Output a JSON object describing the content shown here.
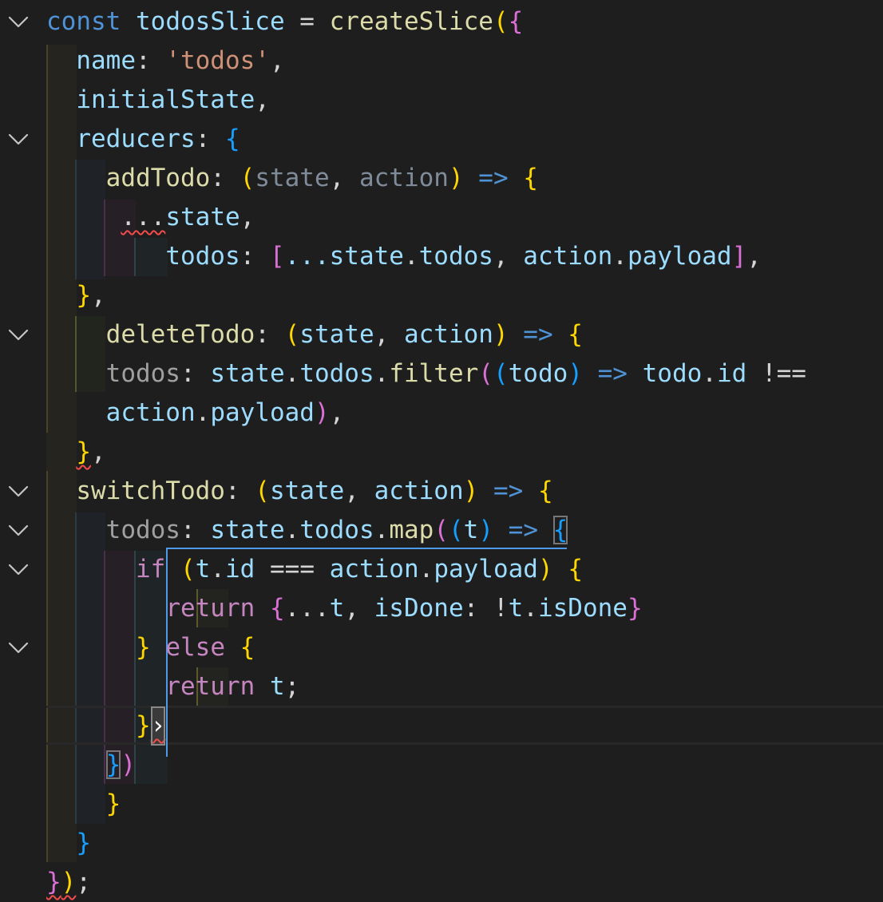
{
  "lines": [
    {
      "t": [
        [
          "kw",
          "const"
        ],
        [
          "punc",
          " "
        ],
        [
          "var",
          "todosSlice"
        ],
        [
          "punc",
          " = "
        ],
        [
          "fn",
          "createSlice"
        ],
        [
          "b1",
          "("
        ],
        [
          "b2",
          "{"
        ]
      ]
    },
    {
      "t": [
        [
          "punc",
          "  "
        ],
        [
          "var",
          "name"
        ],
        [
          "punc",
          ": "
        ],
        [
          "str",
          "'todos'"
        ],
        [
          "punc",
          ","
        ]
      ]
    },
    {
      "t": [
        [
          "punc",
          "  "
        ],
        [
          "var",
          "initialState"
        ],
        [
          "punc",
          ","
        ]
      ]
    },
    {
      "t": [
        [
          "punc",
          "  "
        ],
        [
          "var",
          "reducers"
        ],
        [
          "punc",
          ": "
        ],
        [
          "b3",
          "{"
        ]
      ]
    },
    {
      "t": [
        [
          "punc",
          "    "
        ],
        [
          "fn",
          "addTodo"
        ],
        [
          "punc",
          ": "
        ],
        [
          "b1",
          "("
        ],
        [
          "dim",
          "state"
        ],
        [
          "punc",
          ", "
        ],
        [
          "dim",
          "action"
        ],
        [
          "b1",
          ")"
        ],
        [
          "punc",
          " "
        ],
        [
          "kw",
          "=>"
        ],
        [
          "punc",
          " "
        ],
        [
          "b1",
          "{"
        ]
      ]
    },
    {
      "t": [
        [
          "punc",
          "     "
        ],
        [
          "squig",
          "..."
        ],
        [
          "var",
          "state"
        ],
        [
          "punc",
          ","
        ]
      ]
    },
    {
      "t": [
        [
          "punc",
          "        "
        ],
        [
          "var",
          "todos"
        ],
        [
          "punc",
          ": "
        ],
        [
          "b2",
          "["
        ],
        [
          "var",
          "...state"
        ],
        [
          "punc",
          "."
        ],
        [
          "var",
          "todos"
        ],
        [
          "punc",
          ", "
        ],
        [
          "var",
          "action"
        ],
        [
          "punc",
          "."
        ],
        [
          "var",
          "payload"
        ],
        [
          "b2",
          "]"
        ],
        [
          "punc",
          ","
        ]
      ]
    },
    {
      "t": [
        [
          "punc",
          "  "
        ],
        [
          "b1",
          "}"
        ],
        [
          "punc",
          ","
        ]
      ]
    },
    {
      "t": [
        [
          "punc",
          "    "
        ],
        [
          "fn",
          "deleteTodo"
        ],
        [
          "punc",
          ": "
        ],
        [
          "b1",
          "("
        ],
        [
          "var",
          "state"
        ],
        [
          "punc",
          ", "
        ],
        [
          "var",
          "action"
        ],
        [
          "b1",
          ")"
        ],
        [
          "punc",
          " "
        ],
        [
          "kw",
          "=>"
        ],
        [
          "punc",
          " "
        ],
        [
          "b1",
          "{"
        ]
      ]
    },
    {
      "t": [
        [
          "punc",
          "    "
        ],
        [
          "grey",
          "todos"
        ],
        [
          "punc",
          ": "
        ],
        [
          "var",
          "state"
        ],
        [
          "punc",
          "."
        ],
        [
          "var",
          "todos"
        ],
        [
          "punc",
          "."
        ],
        [
          "fn",
          "filter"
        ],
        [
          "b2",
          "("
        ],
        [
          "b3",
          "("
        ],
        [
          "var",
          "todo"
        ],
        [
          "b3",
          ")"
        ],
        [
          "punc",
          " "
        ],
        [
          "kw",
          "=>"
        ],
        [
          "punc",
          " "
        ],
        [
          "var",
          "todo"
        ],
        [
          "punc",
          "."
        ],
        [
          "var",
          "id"
        ],
        [
          "punc",
          " !=="
        ]
      ]
    },
    {
      "t": [
        [
          "punc",
          "    "
        ],
        [
          "var",
          "action"
        ],
        [
          "punc",
          "."
        ],
        [
          "var",
          "payload"
        ],
        [
          "b2",
          ")"
        ],
        [
          "punc",
          ","
        ]
      ]
    },
    {
      "t": [
        [
          "punc",
          "  "
        ],
        [
          "b1sq",
          "}"
        ],
        [
          "punc",
          ","
        ]
      ]
    },
    {
      "t": [
        [
          "punc",
          "  "
        ],
        [
          "fn",
          "switchTodo"
        ],
        [
          "punc",
          ": "
        ],
        [
          "b1",
          "("
        ],
        [
          "var",
          "state"
        ],
        [
          "punc",
          ", "
        ],
        [
          "var",
          "action"
        ],
        [
          "b1",
          ")"
        ],
        [
          "punc",
          " "
        ],
        [
          "kw",
          "=>"
        ],
        [
          "punc",
          " "
        ],
        [
          "b1",
          "{"
        ]
      ]
    },
    {
      "t": [
        [
          "punc",
          "    "
        ],
        [
          "grey",
          "todos"
        ],
        [
          "punc",
          ": "
        ],
        [
          "var",
          "state"
        ],
        [
          "punc",
          "."
        ],
        [
          "var",
          "todos"
        ],
        [
          "punc",
          "."
        ],
        [
          "fn",
          "map"
        ],
        [
          "b2",
          "("
        ],
        [
          "b3",
          "("
        ],
        [
          "var",
          "t"
        ],
        [
          "b3",
          ")"
        ],
        [
          "punc",
          " "
        ],
        [
          "kw",
          "=>"
        ],
        [
          "punc",
          " "
        ],
        [
          "b3box",
          "{"
        ]
      ]
    },
    {
      "t": [
        [
          "punc",
          "      "
        ],
        [
          "ctl",
          "if"
        ],
        [
          "punc",
          " "
        ],
        [
          "b1",
          "("
        ],
        [
          "var",
          "t"
        ],
        [
          "punc",
          "."
        ],
        [
          "var",
          "id"
        ],
        [
          "punc",
          " === "
        ],
        [
          "var",
          "action"
        ],
        [
          "punc",
          "."
        ],
        [
          "var",
          "payload"
        ],
        [
          "b1",
          ")"
        ],
        [
          "punc",
          " "
        ],
        [
          "b1",
          "{"
        ]
      ]
    },
    {
      "t": [
        [
          "punc",
          "        "
        ],
        [
          "ctl",
          "return"
        ],
        [
          "punc",
          " "
        ],
        [
          "b2",
          "{"
        ],
        [
          "punc",
          "..."
        ],
        [
          "var",
          "t"
        ],
        [
          "punc",
          ", "
        ],
        [
          "var",
          "isDone"
        ],
        [
          "punc",
          ": !"
        ],
        [
          "var",
          "t"
        ],
        [
          "punc",
          "."
        ],
        [
          "var",
          "isDone"
        ],
        [
          "b2",
          "}"
        ]
      ]
    },
    {
      "t": [
        [
          "punc",
          "      "
        ],
        [
          "b1",
          "}"
        ],
        [
          "punc",
          " "
        ],
        [
          "ctl",
          "else"
        ],
        [
          "punc",
          " "
        ],
        [
          "b1",
          "{"
        ]
      ]
    },
    {
      "t": [
        [
          "punc",
          "        "
        ],
        [
          "ctl",
          "return"
        ],
        [
          "punc",
          " "
        ],
        [
          "var",
          "t"
        ],
        [
          "punc",
          ";"
        ]
      ]
    },
    {
      "t": [
        [
          "punc",
          "      "
        ],
        [
          "b1",
          "}"
        ],
        [
          "cursor",
          "›"
        ]
      ]
    },
    {
      "t": [
        [
          "punc",
          "    "
        ],
        [
          "b3box",
          "}"
        ],
        [
          "b2",
          ")"
        ]
      ]
    },
    {
      "t": [
        [
          "punc",
          "    "
        ],
        [
          "b1",
          "}"
        ]
      ]
    },
    {
      "t": [
        [
          "punc",
          "  "
        ],
        [
          "b3",
          "}"
        ]
      ]
    },
    {
      "t": [
        [
          "b2sq",
          "}"
        ],
        [
          "b1sq",
          ")"
        ],
        [
          "punc",
          ";"
        ]
      ]
    }
  ],
  "folds": [
    0,
    3,
    8,
    12,
    13,
    14,
    16
  ]
}
